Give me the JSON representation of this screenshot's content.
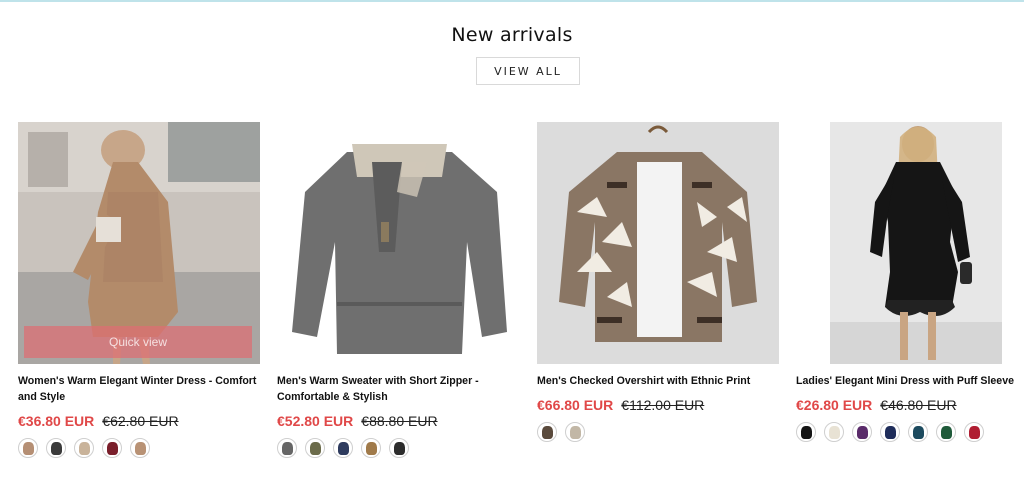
{
  "section": {
    "title": "New arrivals",
    "view_all_label": "VIEW ALL"
  },
  "products": [
    {
      "title": "Women's Warm Elegant Winter Dress - Comfort and Style",
      "sale_price": "€36.80 EUR",
      "old_price": "€62.80 EUR",
      "quick_view_label": "Quick view",
      "swatches": [
        "#b58f74",
        "#3a3a3a",
        "#c9b39a",
        "#7a1f2b",
        "#b89275"
      ]
    },
    {
      "title": "Men's Warm Sweater with Short Zipper - Comfortable & Stylish",
      "sale_price": "€52.80 EUR",
      "old_price": "€88.80 EUR",
      "swatches": [
        "#666666",
        "#6b6b4a",
        "#2e3b5e",
        "#a07a4a",
        "#2d2d2d"
      ]
    },
    {
      "title": "Men's Checked Overshirt with Ethnic Print",
      "sale_price": "€66.80 EUR",
      "old_price": "€112.00 EUR",
      "swatches": [
        "#5a4a3c",
        "#c2b7a6"
      ]
    },
    {
      "title": "Ladies' Elegant Mini Dress with Puff Sleeve",
      "sale_price": "€26.80 EUR",
      "old_price": "€46.80 EUR",
      "swatches": [
        "#151515",
        "#e8e2d4",
        "#5a2b6a",
        "#1f2d5a",
        "#1c4a5e",
        "#1f5a3a",
        "#b01e32"
      ]
    }
  ]
}
